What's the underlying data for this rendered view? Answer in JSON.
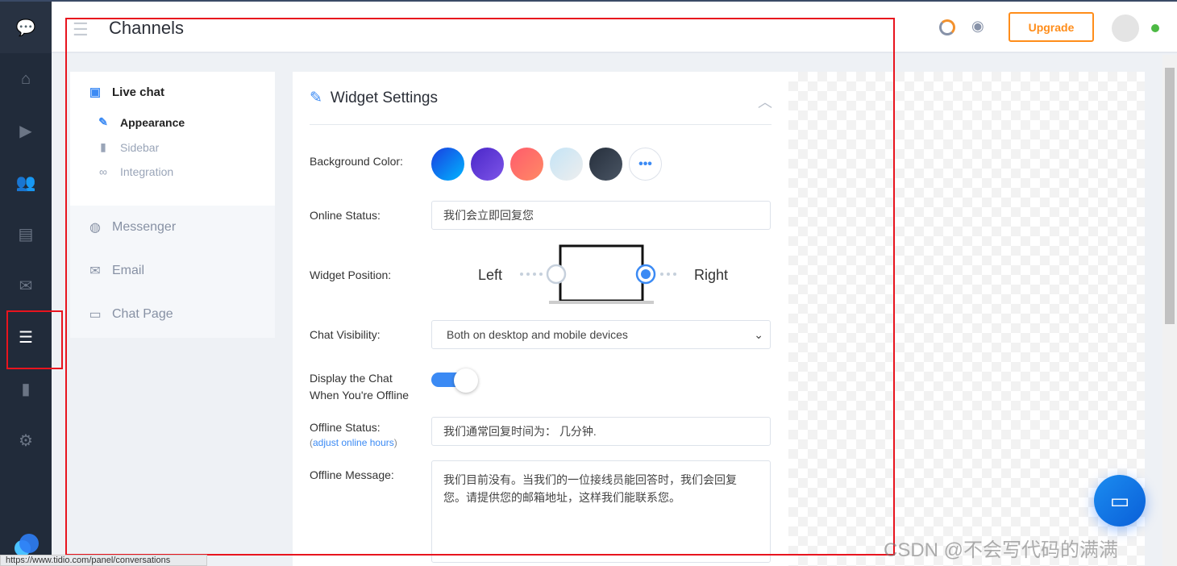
{
  "header": {
    "title": "Channels",
    "upgrade_label": "Upgrade"
  },
  "nav": {
    "items": [
      "chat",
      "home",
      "play",
      "visitors",
      "contacts",
      "inbox",
      "channels",
      "analytics",
      "settings"
    ],
    "active": "channels"
  },
  "menu": {
    "live_chat": "Live chat",
    "subitems": [
      {
        "label": "Appearance",
        "active": true
      },
      {
        "label": "Sidebar"
      },
      {
        "label": "Integration"
      }
    ],
    "channels": [
      "Messenger",
      "Email",
      "Chat Page"
    ]
  },
  "widget": {
    "title": "Widget Settings",
    "background_color_label": "Background Color:",
    "colors": [
      [
        "#1a3ee0",
        "#00b6ff"
      ],
      [
        "#4a26c8",
        "#7d55e8"
      ],
      [
        "#ff5b6c",
        "#ff8a65"
      ],
      [
        "#c4e4f6",
        "#eeeeee"
      ],
      [
        "#262f3c",
        "#4a5564"
      ]
    ],
    "online_status_label": "Online Status:",
    "online_status_value": "我们会立即回复您",
    "widget_position_label": "Widget Position:",
    "position_left": "Left",
    "position_right": "Right",
    "position_selected": "Right",
    "chat_visibility_label": "Chat Visibility:",
    "chat_visibility_value": "Both on desktop and mobile devices",
    "display_offline_label": "Display the Chat When You're Offline",
    "display_offline_on": true,
    "offline_status_label": "Offline Status:",
    "adjust_link": "adjust online hours",
    "offline_status_value": "我们通常回复时间为： 几分钟.",
    "offline_message_label": "Offline Message:",
    "offline_message_value": "我们目前没有。当我们的一位接线员能回答时，我们会回复您。请提供您的邮箱地址，这样我们能联系您。"
  },
  "statusbar": "https://www.tidio.com/panel/conversations",
  "watermark": "CSDN @不会写代码的满满",
  "accent": "#3b8af4"
}
